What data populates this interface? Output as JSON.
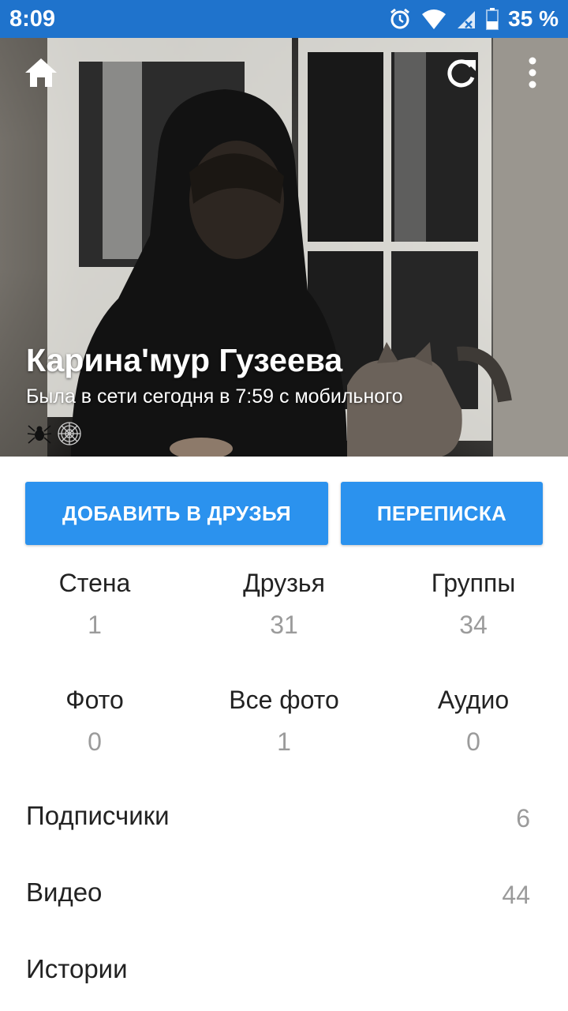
{
  "status_bar": {
    "time": "8:09",
    "battery": "35 %",
    "icons": [
      "alarm-icon",
      "wifi-icon",
      "signal-icon",
      "battery-icon"
    ]
  },
  "app_bar": {
    "icons": [
      "home-icon",
      "refresh-icon",
      "more-vert-icon"
    ]
  },
  "profile": {
    "name": "Карина'мур Гузеева",
    "online_status": "Была в сети сегодня в 7:59 с мобильного",
    "status_emoji": [
      "spider-icon",
      "spider-web-icon"
    ]
  },
  "actions": {
    "add_friend": "ДОБАВИТЬ В ДРУЗЬЯ",
    "messages": "ПЕРЕПИСКА"
  },
  "counters": [
    {
      "label": "Стена",
      "value": "1"
    },
    {
      "label": "Друзья",
      "value": "31"
    },
    {
      "label": "Группы",
      "value": "34"
    },
    {
      "label": "Фото",
      "value": "0"
    },
    {
      "label": "Все фото",
      "value": "1"
    },
    {
      "label": "Аудио",
      "value": "0"
    }
  ],
  "list": [
    {
      "label": "Подписчики",
      "value": "6"
    },
    {
      "label": "Видео",
      "value": "44"
    },
    {
      "label": "Истории",
      "value": ""
    }
  ],
  "colors": {
    "status_bar": "#1f73cc",
    "button": "#2b92ee",
    "counter_value": "#9b9b9b"
  }
}
